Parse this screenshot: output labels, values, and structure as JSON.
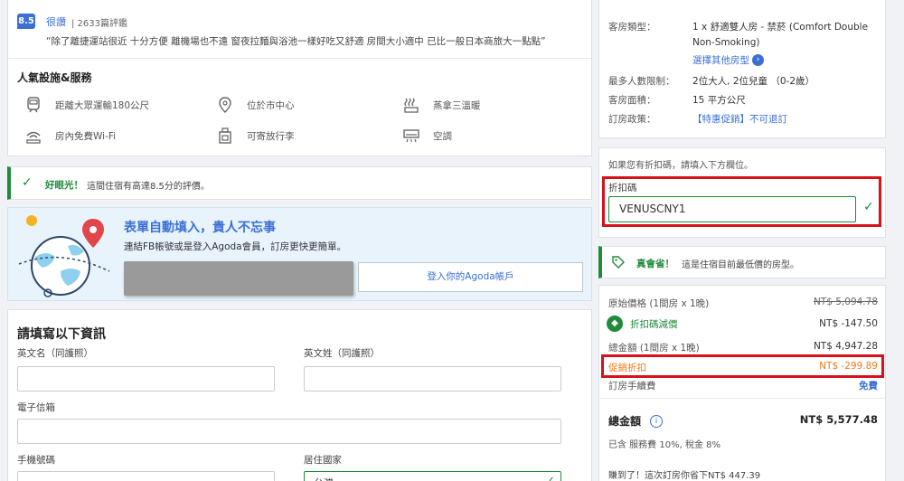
{
  "review": {
    "score": "8.5",
    "word": "很讚",
    "count": "| 2633篇評鑑",
    "quote": "“除了離捷運站很近 十分方便 離機場也不遠 窗夜拉麵與浴池一樣好吃又舒適 房間大小適中 已比一般日本商旅大一點點”"
  },
  "facilities": {
    "title": "人氣設施&服務",
    "items": [
      {
        "label": "距離大眾運輸180公尺",
        "icon": "transit-icon"
      },
      {
        "label": "位於市中心",
        "icon": "location-icon"
      },
      {
        "label": "蒸拿三溫暖",
        "icon": "sauna-icon"
      },
      {
        "label": "房內免費Wi-Fi",
        "icon": "wifi-icon"
      },
      {
        "label": "可寄放行李",
        "icon": "luggage-icon"
      },
      {
        "label": "空調",
        "icon": "air-conditioner-icon"
      }
    ]
  },
  "good_eye": {
    "highlight": "好眼光！",
    "text": "這間住宿有高達8.5分的評價。"
  },
  "autofill": {
    "title": "表單自動填入，貴人不忘事",
    "subtitle": "連結FB帳號或是登入Agoda會員，訂房更快更簡單。",
    "login_label": "登入你的Agoda帳戶"
  },
  "form": {
    "title": "請填寫以下資訊",
    "first_name_label": "英文名（同護照）",
    "last_name_label": "英文姓（同護照）",
    "email_label": "電子信箱",
    "phone_label": "手機號碼",
    "country_label": "居住國家",
    "country_value": "台灣"
  },
  "room": {
    "type_label": "客房類型：",
    "type_value": "1 x 舒適雙人房 - 禁菸 (Comfort Double Non-Smoking)",
    "other_link": "選擇其他房型",
    "max_label": "最多人數限制：",
    "max_value": "2位大人, 2位兒童 （0-2歲）",
    "area_label": "客房面積：",
    "area_value": "15 平方公尺",
    "policy_label": "訂房政策：",
    "policy_value": "【特惠促銷】不可退訂"
  },
  "coupon": {
    "hint": "如果您有折扣碼，請填入下方欄位。",
    "label": "折扣碼",
    "value": "VENUSCNY1"
  },
  "saving": {
    "highlight": "真會省！",
    "text": "這是住宿目前最低價的房型。"
  },
  "price": {
    "original_label": "原始價格 (1間房 x 1晚)",
    "original_value": "NT$ 5,094.78",
    "coupon_label": "折扣碼減價",
    "coupon_value": "NT$ -147.50",
    "total_label": "總金額 (1間房 x 1晚)",
    "total_value": "NT$ 4,947.28",
    "promo_label": "促銷折扣",
    "promo_value": "NT$ -299.89",
    "fee_label": "訂房手續費",
    "fee_value": "免費",
    "grand_label": "總金額",
    "grand_value": "NT$ 5,577.48",
    "tax_note": "已含 服務費 10%, 稅金 8%",
    "earn_note": "賺到了！這次訂房你省下NT$ 447.39"
  },
  "colors": {
    "accent_blue": "#3b6fd6",
    "success_green": "#1f8c3a",
    "promo_orange": "#f07a1a",
    "highlight_red": "#d6111c"
  }
}
